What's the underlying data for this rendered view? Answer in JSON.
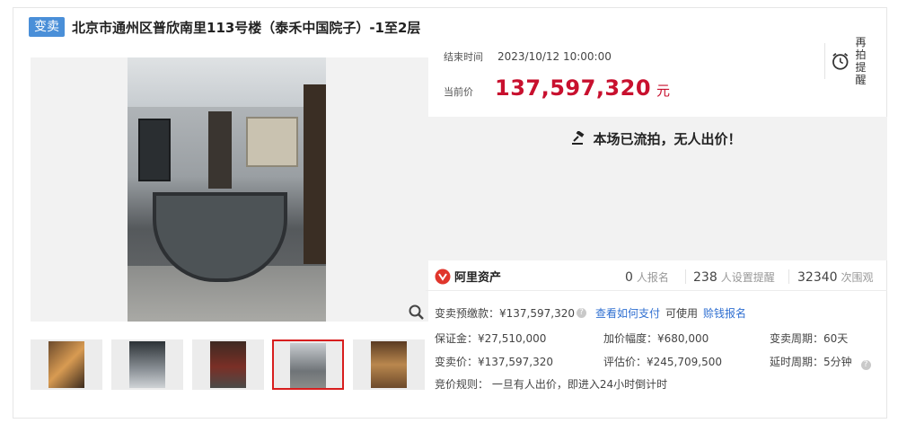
{
  "header": {
    "badge": "变卖",
    "title": "北京市通州区普欣南里113号楼（泰禾中国院子）-1至2层"
  },
  "thumbnails": [
    "thumb-1",
    "thumb-2",
    "thumb-3",
    "thumb-4",
    "thumb-5"
  ],
  "auction": {
    "end_label": "结束时间",
    "end_time": "2023/10/12 10:00:00",
    "price_label": "当前价",
    "price": "137,597,320",
    "price_unit": "元",
    "remind_line1": "再拍",
    "remind_line2": "提醒",
    "status": "本场已流拍，无人出价！"
  },
  "stats": {
    "brand": "阿里资产",
    "signups_num": "0",
    "signups_label": "人报名",
    "reminders_num": "238",
    "reminders_label": "人设置提醒",
    "views_num": "32340",
    "views_label": "次围观"
  },
  "details": {
    "deposit": "变卖预缴款：¥137,597,320",
    "pay_link": "查看如何支付",
    "usable": "可使用",
    "loan_link": "赊钱报名",
    "bond": "保证金：¥27,510,000",
    "increment": "加价幅度：¥680,000",
    "period": "变卖周期：60天",
    "sale_price": "变卖价：¥137,597,320",
    "appraisal": "评估价：¥245,709,500",
    "delay": "延时周期：5分钟",
    "rule": "竞价规则：  一旦有人出价，即进入24小时倒计时"
  },
  "colors": {
    "accent_red": "#c8102e",
    "badge_blue": "#4a8fd8",
    "link_blue": "#2f6fd1"
  }
}
